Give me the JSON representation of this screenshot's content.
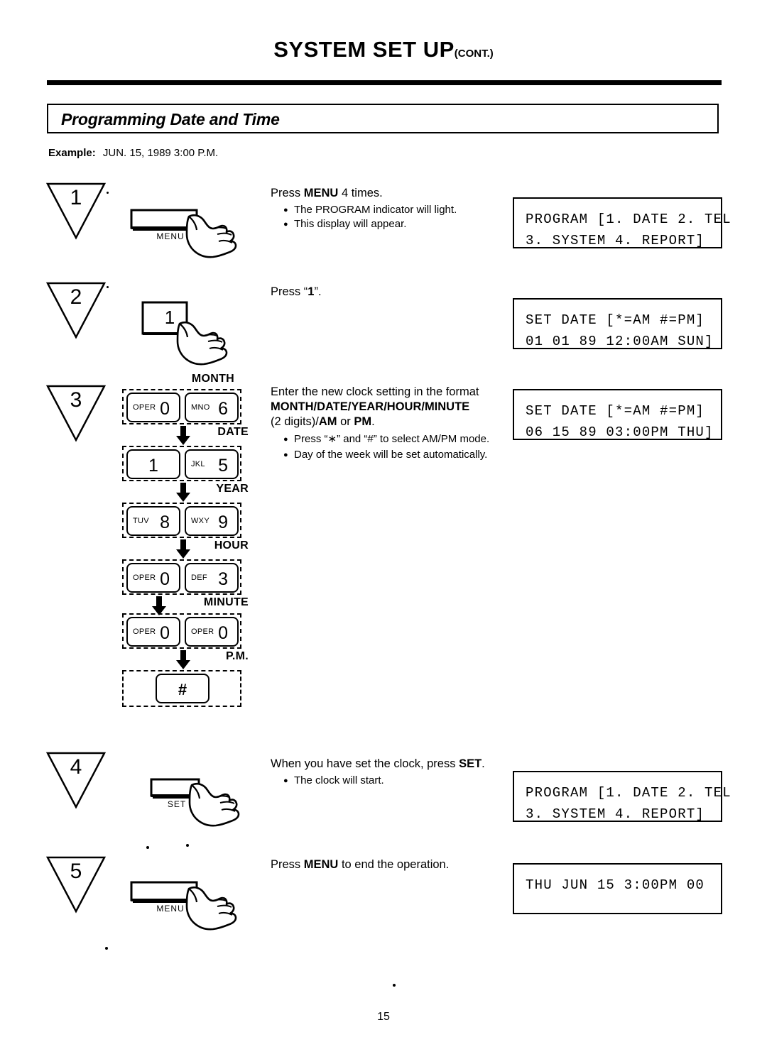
{
  "header": {
    "title": "SYSTEM SET UP",
    "title_suffix": "(CONT.)",
    "section_title": "Programming Date and Time",
    "example_label": "Example:",
    "example_value": "JUN. 15, 1989 3:00 P.M."
  },
  "steps": [
    {
      "number": "1",
      "button_label": "MENU",
      "instruction_pre": "Press ",
      "instruction_hl": "MENU",
      "instruction_post": " 4 times.",
      "bullets": [
        "The PROGRAM indicator will light.",
        "This display will appear."
      ],
      "display_line1": "PROGRAM [1. DATE 2. TEL",
      "display_line2": "3. SYSTEM 4. REPORT]"
    },
    {
      "number": "2",
      "button_label": "1",
      "instruction_pre": "Press “",
      "instruction_hl": "1",
      "instruction_post": "”.",
      "bullets": [],
      "display_line1": "SET DATE [*=AM #=PM]",
      "display_line2": "01 01 89 12:00AM SUN]"
    },
    {
      "number": "3",
      "instruction_line1": "Enter the new clock setting in the format",
      "instruction_line2": "MONTH/DATE/YEAR/HOUR/MINUTE",
      "instruction_line3_pre": "(2 digits)/",
      "instruction_line3_hl1": "AM",
      "instruction_line3_mid": " or ",
      "instruction_line3_hl2": "PM",
      "instruction_line3_post": ".",
      "bullets": [
        "Press “∗” and “#” to select AM/PM mode.",
        "Day of the week will be set automatically."
      ],
      "display_line1": "SET DATE [*=AM #=PM]",
      "display_line2": "06 15 89 03:00PM THU]"
    },
    {
      "number": "4",
      "button_label": "SET",
      "instruction_pre": "When you have set the clock, press ",
      "instruction_hl": "SET",
      "instruction_post": ".",
      "bullets": [
        "The clock will start."
      ],
      "display_line1": "PROGRAM [1. DATE 2. TEL",
      "display_line2": "3. SYSTEM 4. REPORT]"
    },
    {
      "number": "5",
      "button_label": "MENU",
      "instruction_pre": "Press ",
      "instruction_hl": "MENU",
      "instruction_post": " to end the operation.",
      "bullets": [],
      "display_line1": "THU JUN 15 3:00PM 00",
      "display_line2": ""
    }
  ],
  "keypad": {
    "groups": [
      {
        "label": "MONTH",
        "keys": [
          {
            "letters": "OPER",
            "digit": "0"
          },
          {
            "letters": "MNO",
            "digit": "6"
          }
        ]
      },
      {
        "label": "DATE",
        "keys": [
          {
            "letters": "",
            "digit": "1"
          },
          {
            "letters": "JKL",
            "digit": "5"
          }
        ]
      },
      {
        "label": "YEAR",
        "keys": [
          {
            "letters": "TUV",
            "digit": "8"
          },
          {
            "letters": "WXY",
            "digit": "9"
          }
        ]
      },
      {
        "label": "HOUR",
        "keys": [
          {
            "letters": "OPER",
            "digit": "0"
          },
          {
            "letters": "DEF",
            "digit": "3"
          }
        ]
      },
      {
        "label": "MINUTE",
        "keys": [
          {
            "letters": "OPER",
            "digit": "0"
          },
          {
            "letters": "OPER",
            "digit": "0"
          }
        ]
      },
      {
        "label": "P.M.",
        "keys": [
          {
            "letters": "",
            "digit": "#"
          }
        ]
      }
    ]
  },
  "footer": {
    "page_number": "15"
  }
}
